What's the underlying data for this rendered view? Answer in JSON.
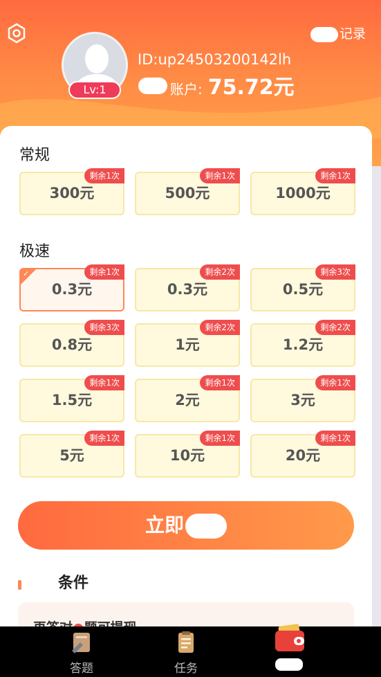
{
  "header": {
    "record_label": "记录",
    "user_id": "ID:up24503200142lh",
    "account_label": "账户:",
    "balance": "75.72元",
    "level": "Lv:1"
  },
  "sections": {
    "regular": "常规",
    "fast": "极速"
  },
  "regular_tiles": [
    {
      "amount": "300元",
      "remain": "剩余1次"
    },
    {
      "amount": "500元",
      "remain": "剩余1次"
    },
    {
      "amount": "1000元",
      "remain": "剩余1次"
    }
  ],
  "fast_tiles": [
    {
      "amount": "0.3元",
      "remain": "剩余1次",
      "selected": true
    },
    {
      "amount": "0.3元",
      "remain": "剩余2次"
    },
    {
      "amount": "0.5元",
      "remain": "剩余3次"
    },
    {
      "amount": "0.8元",
      "remain": "剩余3次"
    },
    {
      "amount": "1元",
      "remain": "剩余2次"
    },
    {
      "amount": "1.2元",
      "remain": "剩余2次"
    },
    {
      "amount": "1.5元",
      "remain": "剩余1次"
    },
    {
      "amount": "2元",
      "remain": "剩余1次"
    },
    {
      "amount": "3元",
      "remain": "剩余1次"
    },
    {
      "amount": "5元",
      "remain": "剩余1次"
    },
    {
      "amount": "10元",
      "remain": "剩余1次"
    },
    {
      "amount": "20元",
      "remain": "剩余1次"
    }
  ],
  "action": {
    "button": "立即"
  },
  "conditions": {
    "title": "条件",
    "note": "再答对",
    "note2": "题可提现"
  },
  "tabs": [
    {
      "label": "答题",
      "icon": "quiz-icon"
    },
    {
      "label": "任务",
      "icon": "task-icon"
    },
    {
      "label": "",
      "icon": "wallet-icon"
    }
  ],
  "colors": {
    "primary": "#ff6a3f",
    "accent": "#ef4d4d",
    "tile_bg": "#fff9dd"
  }
}
